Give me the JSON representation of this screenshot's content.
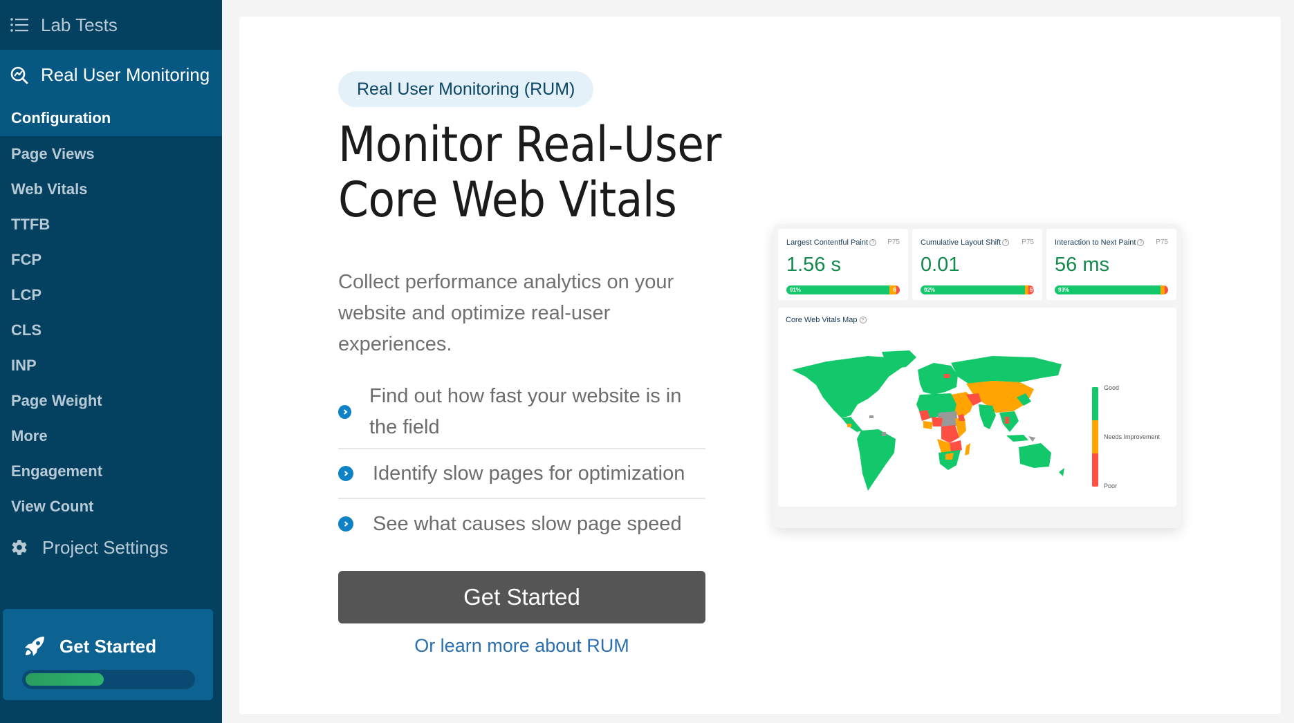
{
  "sidebar": {
    "lab_tests": "Lab Tests",
    "section_title": "Real User Monitoring",
    "items": [
      {
        "label": "Configuration",
        "active": true
      },
      {
        "label": "Page Views"
      },
      {
        "label": "Web Vitals"
      },
      {
        "label": "TTFB"
      },
      {
        "label": "FCP"
      },
      {
        "label": "LCP"
      },
      {
        "label": "CLS"
      },
      {
        "label": "INP"
      },
      {
        "label": "Page Weight"
      },
      {
        "label": "More"
      },
      {
        "label": "Engagement"
      },
      {
        "label": "View Count"
      }
    ],
    "project_settings": "Project Settings",
    "get_started": {
      "label": "Get Started",
      "progress_percent": 47
    }
  },
  "main": {
    "badge": "Real User Monitoring (RUM)",
    "title_line1": "Monitor Real-User",
    "title_line2": "Core Web Vitals",
    "description": "Collect performance analytics on your website and optimize real-user experiences.",
    "features": [
      "Find out how fast your website is in the field",
      "Identify slow pages for optimization",
      "See what causes slow page speed"
    ],
    "cta_label": "Get Started",
    "learn_more": "Or learn more about RUM"
  },
  "preview": {
    "metrics": [
      {
        "name": "Largest Contentful Paint",
        "percentile": "P75",
        "value": "1.56 s",
        "good": 91,
        "needs_improvement": 6,
        "poor": 3,
        "good_label": "91%",
        "ni_label": "6%",
        "poor_label": ""
      },
      {
        "name": "Cumulative Layout Shift",
        "percentile": "P75",
        "value": "0.01",
        "good": 92,
        "needs_improvement": 3,
        "poor": 5,
        "good_label": "92%",
        "ni_label": "",
        "poor_label": "5%"
      },
      {
        "name": "Interaction to Next Paint",
        "percentile": "P75",
        "value": "56 ms",
        "good": 93,
        "needs_improvement": 4,
        "poor": 3,
        "good_label": "93%",
        "ni_label": "",
        "poor_label": ""
      }
    ],
    "map": {
      "title": "Core Web Vitals Map",
      "legend": [
        "Good",
        "Needs Improvement",
        "Poor"
      ],
      "colors": {
        "good": "#12c86a",
        "needs_improvement": "#ffa400",
        "poor": "#ff4e42",
        "no_data": "#999999"
      }
    }
  }
}
